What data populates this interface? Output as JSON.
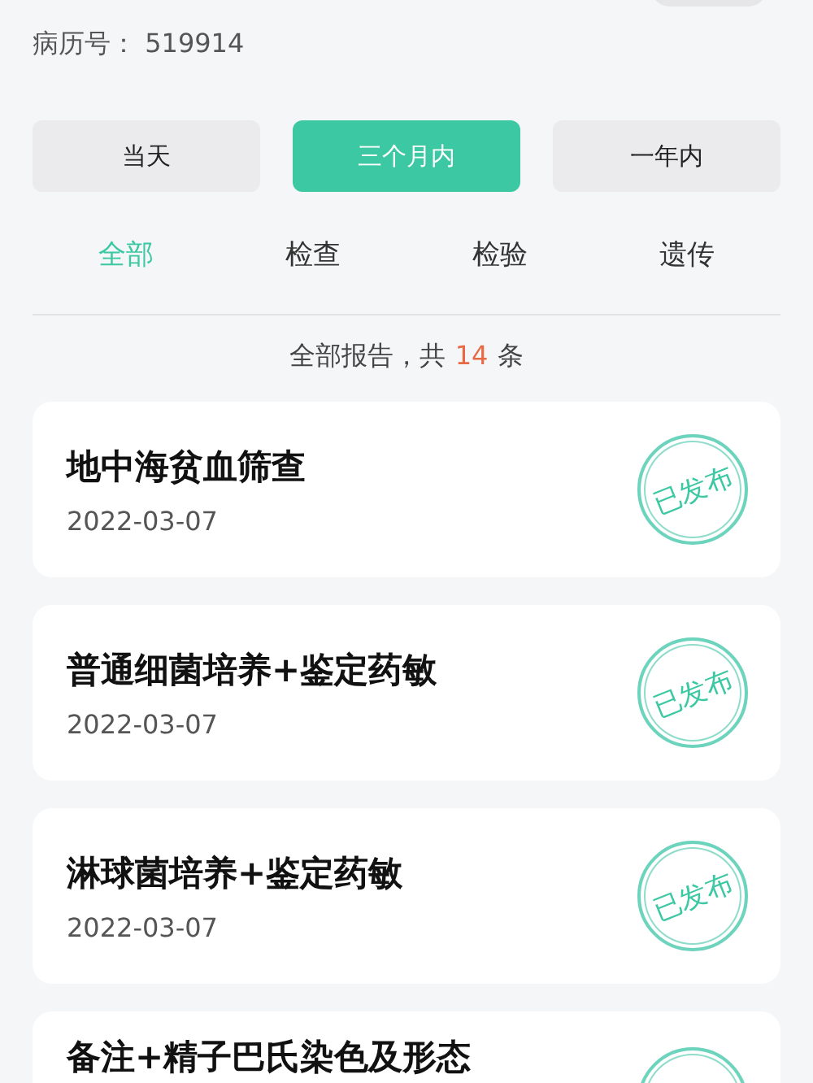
{
  "patient": {
    "record_label": "病历号：",
    "record_number": "519914"
  },
  "range_tabs": [
    {
      "label": "当天",
      "selected": false
    },
    {
      "label": "三个月内",
      "selected": true
    },
    {
      "label": "一年内",
      "selected": false
    }
  ],
  "category_tabs": [
    {
      "label": "全部",
      "selected": true
    },
    {
      "label": "检查",
      "selected": false
    },
    {
      "label": "检验",
      "selected": false
    },
    {
      "label": "遗传",
      "selected": false
    }
  ],
  "summary": {
    "prefix": "全部报告，共",
    "count": "14",
    "suffix": "条"
  },
  "reports": [
    {
      "title": "地中海贫血筛查",
      "date": "2022-03-07",
      "status": "已发布"
    },
    {
      "title": "普通细菌培养+鉴定药敏",
      "date": "2022-03-07",
      "status": "已发布"
    },
    {
      "title": "淋球菌培养+鉴定药敏",
      "date": "2022-03-07",
      "status": "已发布"
    },
    {
      "title": "备注+精子巴氏染色及形态",
      "status_stamp": true
    }
  ]
}
